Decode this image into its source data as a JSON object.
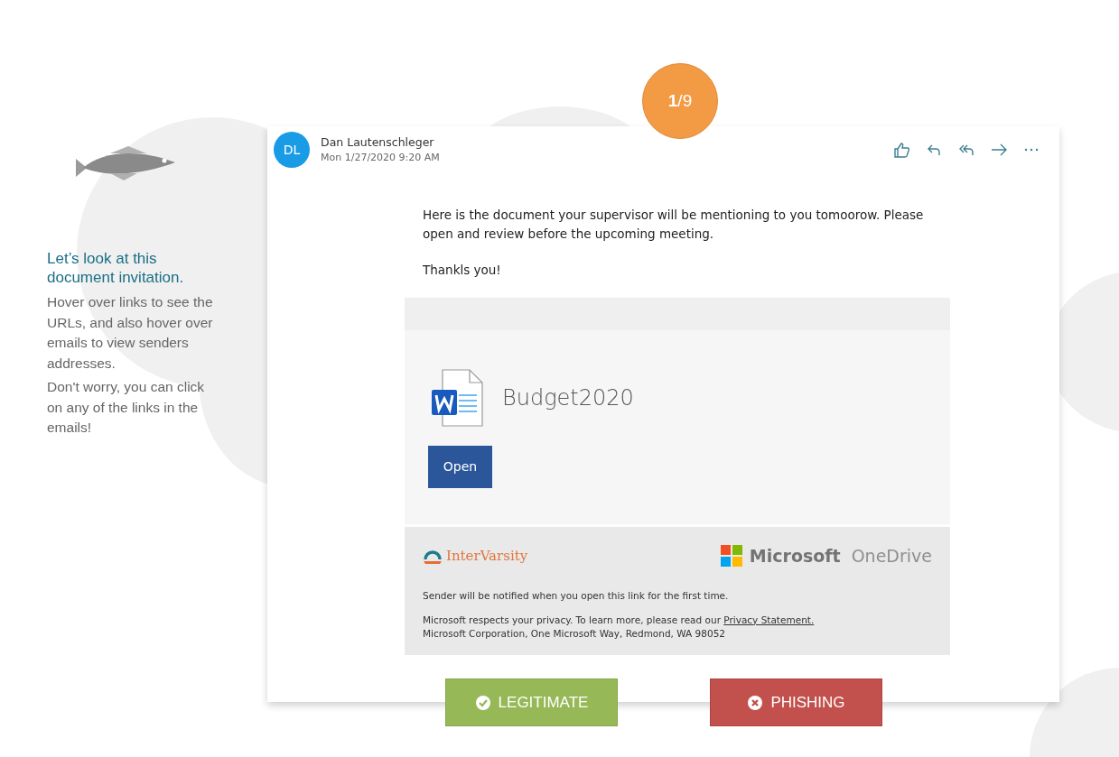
{
  "counter": "**1**/9",
  "intro": {
    "heading": "Let’s look at this document invitation.",
    "paragraphs": [
      "Hover over links to see the URLs, and also hover over emails to view senders addresses.",
      "Don't worry, you can click on any of the links in the emails!"
    ]
  },
  "email": {
    "avatar": "DL",
    "sender": "Dan Lautenschleger",
    "date": "Mon 1/27/2020 9:20 AM",
    "actions": [
      {
        "kind": "like"
      },
      {
        "kind": "reply"
      },
      {
        "kind": "reply_all"
      },
      {
        "kind": "forward"
      },
      {
        "kind": "more"
      }
    ],
    "body": [
      "Here is the document your supervisor will be mentioning to you tomoorow. Please open and review before the upcoming meeting.",
      "Thankls you!"
    ],
    "document": {
      "name": "Budget2020",
      "button": "Open"
    },
    "footer": {
      "org": "InterVarsity",
      "brand": "Microsoft",
      "product": "OneDrive",
      "notice": "Sender will be notified when you open this link for the first time.",
      "privacy": "Microsoft respects your privacy. To learn more, please read our",
      "privacy_link": "Privacy Statement.",
      "address": "Microsoft Corporation, One Microsoft Way, Redmond, WA 98052"
    }
  },
  "answers": [
    {
      "kind": "legitimate",
      "label": "LEGITIMATE"
    },
    {
      "kind": "phishing",
      "label": "PHISHING"
    }
  ]
}
